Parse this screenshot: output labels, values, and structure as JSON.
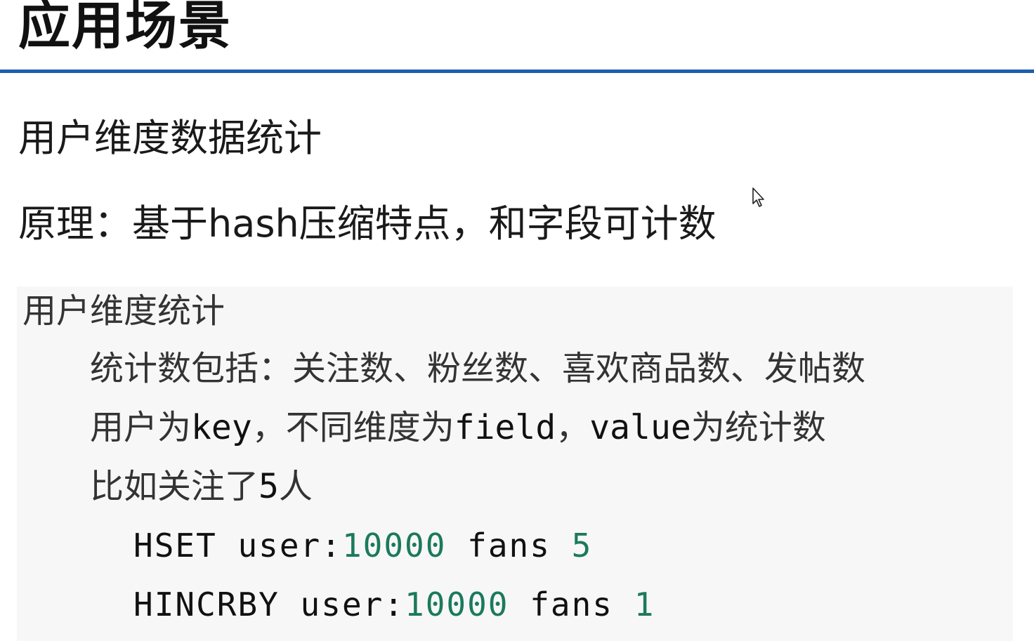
{
  "slide": {
    "title": "应用场景",
    "subtitle": "用户维度数据统计",
    "principle": "原理：基于hash压缩特点，和字段可计数"
  },
  "code_block": {
    "heading": "用户维度统计",
    "line1": "统计数包括：关注数、粉丝数、喜欢商品数、发帖数",
    "line2": {
      "p1": "用户为",
      "p2": "key",
      "p3": "，不同维度为",
      "p4": "field",
      "p5": "，",
      "p6": "value",
      "p7": "为统计数"
    },
    "line3": {
      "p1": "比如关注了",
      "p2": "5",
      "p3": "人"
    },
    "command1": {
      "cmd": "HSET user:",
      "id": "10000",
      "field": " fans ",
      "value": "5"
    },
    "command2": {
      "cmd": "HINCRBY user:",
      "id": "10000",
      "field": " fans ",
      "value": "1"
    }
  },
  "colors": {
    "accent_rule": "#1f5fae",
    "number_green": "#1b7a5c",
    "code_background": "#f7f7f7"
  },
  "icons": {
    "cursor": "mouse-pointer-icon"
  }
}
